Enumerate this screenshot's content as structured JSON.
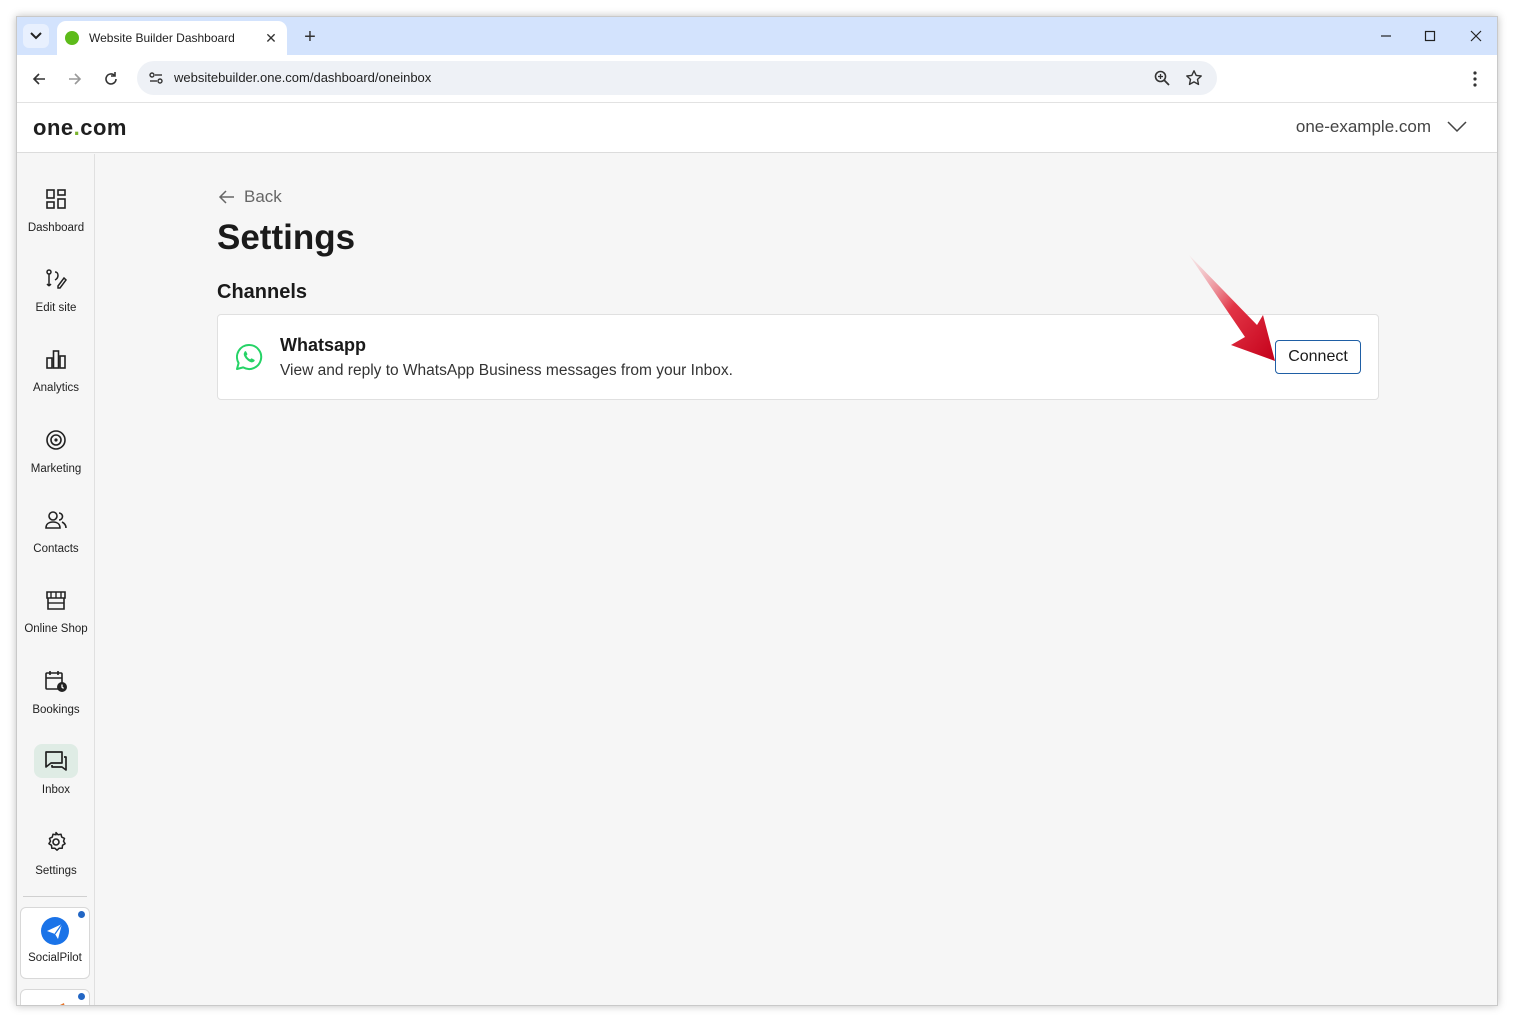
{
  "browser": {
    "tab_title": "Website Builder Dashboard",
    "url": "websitebuilder.one.com/dashboard/oneinbox"
  },
  "header": {
    "logo_pre": "one",
    "logo_dot": ".",
    "logo_post": "com",
    "domain": "one-example.com"
  },
  "sidebar": {
    "items": [
      {
        "label": "Dashboard"
      },
      {
        "label": "Edit site"
      },
      {
        "label": "Analytics"
      },
      {
        "label": "Marketing"
      },
      {
        "label": "Contacts"
      },
      {
        "label": "Online Shop"
      },
      {
        "label": "Bookings"
      },
      {
        "label": "Inbox"
      },
      {
        "label": "Settings"
      }
    ],
    "apps": [
      {
        "label": "SocialPilot"
      }
    ]
  },
  "main": {
    "back_label": "Back",
    "title": "Settings",
    "section_title": "Channels",
    "channels": [
      {
        "name": "Whatsapp",
        "description": "View and reply to WhatsApp Business messages from your Inbox.",
        "action_label": "Connect"
      }
    ]
  },
  "colors": {
    "brand_green": "#7ab32e",
    "active_nav_bg": "#dfece5",
    "button_border": "#1f5fa5",
    "annotation_arrow": "#d0101e",
    "whatsapp_green": "#25d366"
  }
}
